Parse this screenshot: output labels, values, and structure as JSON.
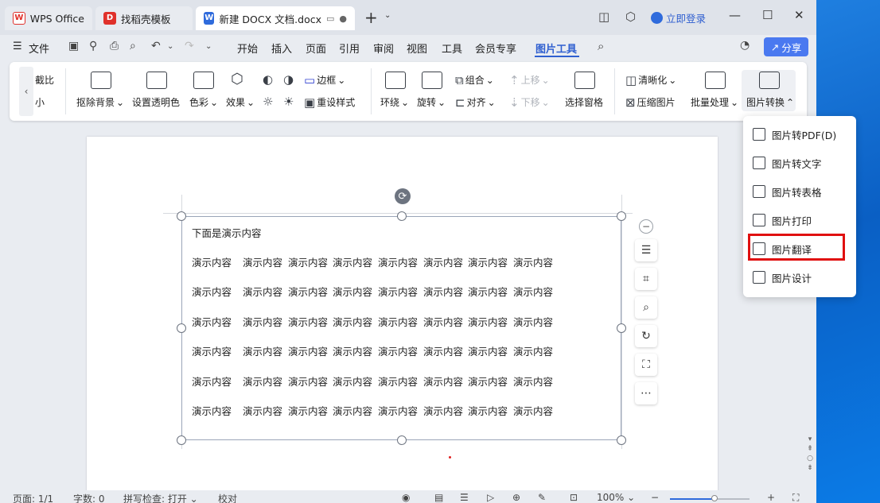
{
  "tabs": [
    {
      "label": "WPS Office",
      "icon": "wps-logo-icon"
    },
    {
      "label": "找稻壳模板",
      "icon": "docer-logo-icon"
    },
    {
      "label": "新建 DOCX 文档.docx",
      "icon": "word-doc-icon"
    }
  ],
  "titlebar": {
    "login_label": "立即登录"
  },
  "menubar": {
    "file_label": "文件",
    "items": [
      "开始",
      "插入",
      "页面",
      "引用",
      "审阅",
      "视图",
      "工具",
      "会员专享",
      "图片工具"
    ],
    "active": "图片工具",
    "share_label": "分享"
  },
  "ribbon": {
    "crop_top": "截比",
    "crop_bottom": "小",
    "remove_bg": "抠除背景",
    "set_transparent": "设置透明色",
    "color": "色彩",
    "effects": "效果",
    "border": "边框",
    "reset_style": "重设样式",
    "wrap": "环绕",
    "rotate": "旋转",
    "group": "组合",
    "align": "对齐",
    "move_up": "上移",
    "move_down": "下移",
    "selection_pane": "选择窗格",
    "sharpen": "清晰化",
    "compress": "压缩图片",
    "batch": "批量处理",
    "convert": "图片转换"
  },
  "dropdown": {
    "items": [
      "图片转PDF(D)",
      "图片转文字",
      "图片转表格",
      "图片打印",
      "图片翻译",
      "图片设计"
    ],
    "highlighted": "图片翻译"
  },
  "document": {
    "heading": "下面是演示内容",
    "cell_text": "演示内容",
    "rows": 6,
    "cols": 8
  },
  "statusbar": {
    "page": "页面: 1/1",
    "words": "字数: 0",
    "spellcheck": "拼写检查: 打开",
    "proofread": "校对",
    "zoom": "100%"
  },
  "colors": {
    "accent": "#2f5fd0",
    "share_bg": "#4a79f0",
    "highlight_border": "#e01010"
  }
}
